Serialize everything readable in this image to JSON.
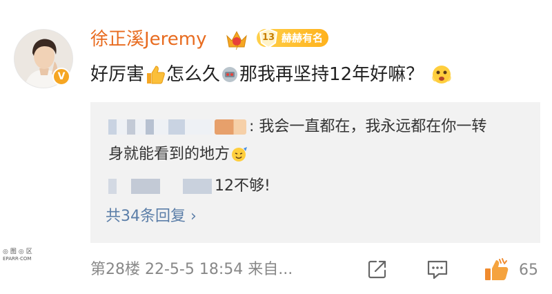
{
  "user": {
    "name": "徐正溪Jeremy",
    "verified_mark": "V",
    "level_number": "13",
    "level_title": "赫赫有名",
    "crown_level": "7"
  },
  "comment": {
    "part1": "好厉害",
    "part2": "怎么久",
    "part3": "那我再坚持12年好嘛？"
  },
  "replies": {
    "reply1_line1": ": 我会一直都在，我永远都在你一转",
    "reply1_line2": "身就能看到的地方",
    "reply2_text": "12不够!",
    "more_label": "共34条回复 ›"
  },
  "footer": {
    "meta": "第28楼  22-5-5 18:54  来自...",
    "like_count": "65"
  },
  "watermark": {
    "line1": "◎图◎区",
    "line2": "EPARR·COM"
  },
  "colors": {
    "username": "#e86b1f",
    "link": "#5b7ea8",
    "reply_bg": "#f2f2f2",
    "meta": "#888888",
    "badge": "#ffb21c"
  }
}
